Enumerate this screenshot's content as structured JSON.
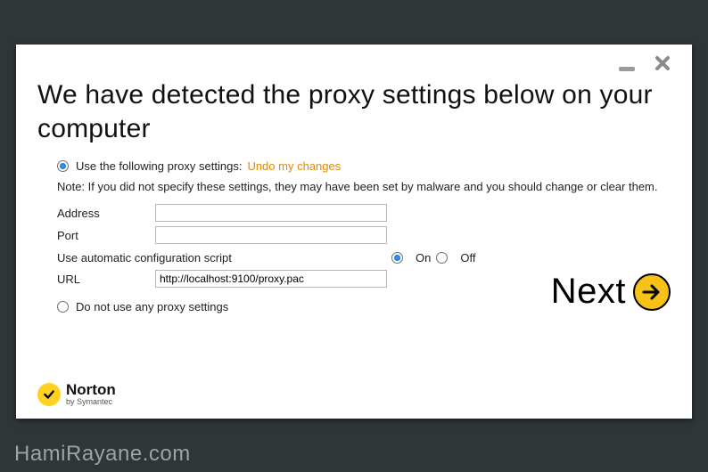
{
  "window": {
    "minimize_tooltip": "Minimize",
    "close_tooltip": "Close"
  },
  "heading": "We have detected the proxy settings below on your computer",
  "proxy": {
    "use_label": "Use the following proxy settings:",
    "undo_label": "Undo my changes",
    "note": "Note: If you did not specify these settings, they may have been set by malware and you should change or clear them.",
    "address_label": "Address",
    "address_value": "",
    "port_label": "Port",
    "port_value": "",
    "auto_label": "Use automatic configuration script",
    "on_label": "On",
    "off_label": "Off",
    "auto_selected": "On",
    "url_label": "URL",
    "url_value": "http://localhost:9100/proxy.pac",
    "no_proxy_label": "Do not use any proxy settings",
    "mode_selected": "use"
  },
  "next_label": "Next",
  "brand": {
    "name": "Norton",
    "subtitle": "by Symantec"
  },
  "colors": {
    "accent_yellow": "#f6c21a",
    "link_orange": "#e08a00"
  },
  "watermark": "HamiRayane.com"
}
